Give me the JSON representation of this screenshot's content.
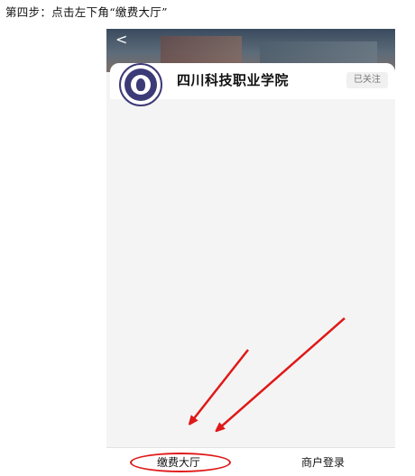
{
  "instruction": {
    "text": "第四步：点击左下角“缴费大厅”"
  },
  "header": {
    "school_name": "四川科技职业学院",
    "follow_badge": "已关注"
  },
  "bottom_bar": {
    "tabs": [
      {
        "label": "缴费大厅"
      },
      {
        "label": "商户登录"
      }
    ]
  },
  "colors": {
    "annotation_red": "#e01818",
    "logo_purple": "#3d3a78"
  },
  "icons": [
    "back-icon",
    "school-logo"
  ]
}
